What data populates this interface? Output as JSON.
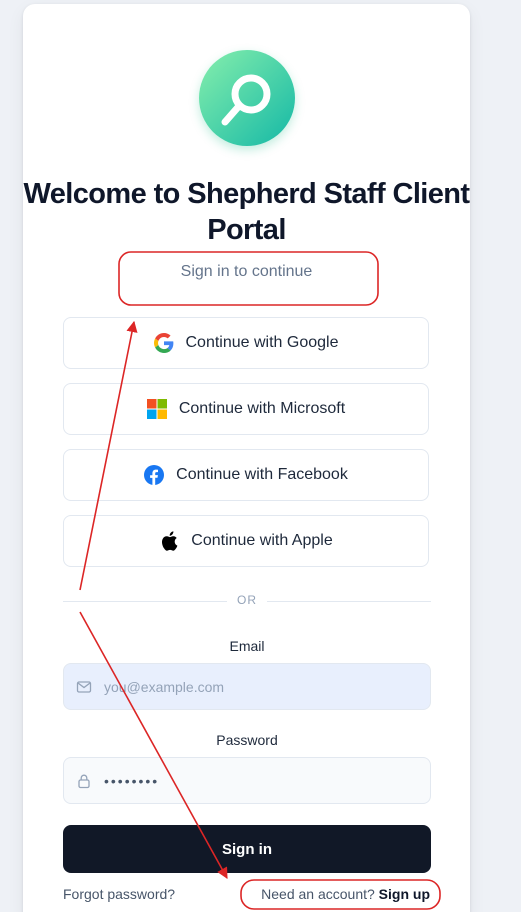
{
  "header": {
    "title": "Welcome to Shepherd Staff Client Portal",
    "subtitle": "Sign in to continue"
  },
  "oauth": [
    {
      "label": "Continue with Google",
      "icon": "google-icon"
    },
    {
      "label": "Continue with Microsoft",
      "icon": "microsoft-icon"
    },
    {
      "label": "Continue with Facebook",
      "icon": "facebook-icon"
    },
    {
      "label": "Continue with Apple",
      "icon": "apple-icon"
    }
  ],
  "divider": {
    "label": "OR"
  },
  "form": {
    "email_label": "Email",
    "email_placeholder": "you@example.com",
    "email_icon": "mail-icon",
    "password_label": "Password",
    "password_value": "••••••••",
    "password_icon": "lock-icon",
    "submit_label": "Sign in"
  },
  "footer": {
    "forgot_label": "Forgot password?",
    "need_account_label": "Need an account?",
    "signup_label": "Sign up"
  },
  "colors": {
    "accent_gradient_start": "#6ee7b7",
    "accent_gradient_end": "#14b8a6",
    "primary_button": "#111827",
    "annotation": "#dc2626"
  }
}
